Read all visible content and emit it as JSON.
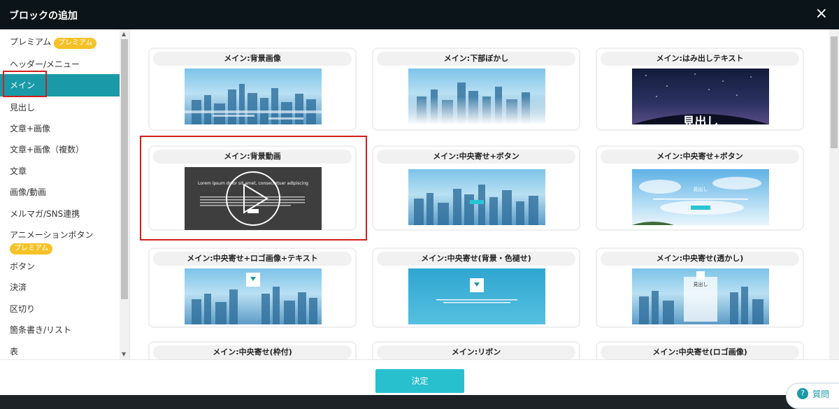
{
  "dialog": {
    "title": "ブロックの追加",
    "close_label": "×"
  },
  "sidebar": {
    "premium_badge": "プレミアム",
    "items": [
      {
        "label": "プレミアム",
        "badge": "プレミアム"
      },
      {
        "label": "ヘッダー/メニュー"
      },
      {
        "label": "メイン",
        "active": true
      },
      {
        "label": "見出し"
      },
      {
        "label": "文章+画像"
      },
      {
        "label": "文章+画像（複数）"
      },
      {
        "label": "文章"
      },
      {
        "label": "画像/動画"
      },
      {
        "label": "メルマガ/SNS連携"
      },
      {
        "label": "アニメーションボタン",
        "badge": "プレミアム"
      },
      {
        "label": "ボタン"
      },
      {
        "label": "決済"
      },
      {
        "label": "区切り"
      },
      {
        "label": "箇条書き/リスト"
      },
      {
        "label": "表"
      }
    ]
  },
  "blocks": [
    {
      "title": "メイン:背景画像"
    },
    {
      "title": "メイン:下部ぼかし"
    },
    {
      "title": "メイン:はみ出しテキスト",
      "overlay": "見出し"
    },
    {
      "title": "メイン:背景動画",
      "overlay": "Lorem ipsum dolor sit amet, consectetuer adipiscing"
    },
    {
      "title": "メイン:中央寄せ+ボタン"
    },
    {
      "title": "メイン:中央寄せ+ボタン",
      "overlay": "見出し"
    },
    {
      "title": "メイン:中央寄せ+ロゴ画像+テキスト"
    },
    {
      "title": "メイン:中央寄せ(背景・色褪せ)"
    },
    {
      "title": "メイン:中央寄せ(透かし)",
      "overlay": "見出し"
    },
    {
      "title": "メイン:中央寄せ(枠付)"
    },
    {
      "title": "メイン:リボン"
    },
    {
      "title": "メイン:中央寄せ(ロゴ画像)"
    }
  ],
  "footer": {
    "decide_label": "決定",
    "help_label": "質問"
  },
  "colors": {
    "accent": "#1a9aa8",
    "highlight": "#d31e1e",
    "badge": "#f4c227",
    "titlebar": "#0b1419"
  }
}
